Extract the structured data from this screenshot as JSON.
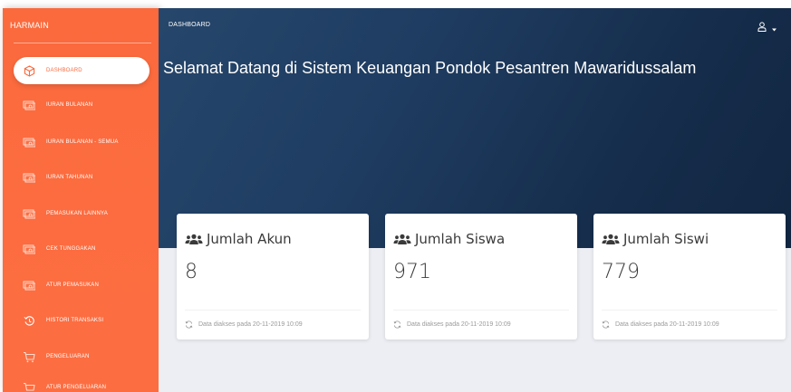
{
  "sidebar": {
    "brand": "HARMAIN",
    "items": [
      {
        "label": "DASHBOARD",
        "icon": "cube-icon",
        "active": true
      },
      {
        "label": "IURAN BULANAN",
        "icon": "money-icon",
        "active": false
      },
      {
        "label": "IURAN BULANAN - SEMUA",
        "icon": "money-icon",
        "active": false
      },
      {
        "label": "IURAN TAHUNAN",
        "icon": "money-icon",
        "active": false
      },
      {
        "label": "PEMASUKAN LAINNYA",
        "icon": "money-icon",
        "active": false
      },
      {
        "label": "CEK TUNGGAKAN",
        "icon": "money-icon",
        "active": false
      },
      {
        "label": "ATUR PEMASUKAN",
        "icon": "money-icon",
        "active": false
      },
      {
        "label": "HISTORI TRANSAKSI",
        "icon": "history-icon",
        "active": false
      },
      {
        "label": "PENGELUARAN",
        "icon": "cart-icon",
        "active": false
      },
      {
        "label": "ATUR PENGELUARAN",
        "icon": "cart-icon",
        "active": false
      }
    ]
  },
  "header": {
    "title": "DASHBOARD",
    "user_icon": "user-icon",
    "caret_icon": "caret-down-icon"
  },
  "main": {
    "welcome": "Selamat Datang di Sistem Keuangan Pondok Pesantren Mawaridussalam"
  },
  "cards": [
    {
      "title": "Jumlah Akun",
      "value": "8",
      "footer": "Data diakses pada 20-11-2019 10:09",
      "icon": "users-icon"
    },
    {
      "title": "Jumlah Siswa",
      "value": "971",
      "footer": "Data diakses pada 20-11-2019 10:09",
      "icon": "users-icon"
    },
    {
      "title": "Jumlah Siswi",
      "value": "779",
      "footer": "Data diakses pada 20-11-2019 10:09",
      "icon": "users-icon"
    }
  ],
  "colors": {
    "sidebar": "#fb6b3f",
    "hero": "#1d3a5e",
    "background": "#eceef3",
    "card": "#ffffff"
  }
}
